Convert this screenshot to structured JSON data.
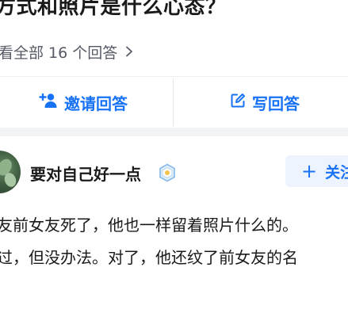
{
  "question": {
    "title": "方式和照片是什么心态？"
  },
  "view_all": {
    "label": "看全部 16 个回答"
  },
  "actions": {
    "invite_label": "邀请回答",
    "write_label": "写回答"
  },
  "answer": {
    "author_name": "要对自己好一点",
    "follow_label": "关注",
    "text_lines": [
      "友前女友死了，他也一样留着照片什么的。",
      "过，但没办法。对了，他还纹了前女友的名"
    ]
  },
  "colors": {
    "accent": "#1772f6",
    "follow_bg": "#eef4fe",
    "band": "#f3f4f6"
  },
  "icons": {
    "view_all": "chevron-right-icon",
    "invite": "invite-user-icon",
    "write": "edit-icon",
    "follow": "plus-icon",
    "badge": "user-badge-icon"
  }
}
